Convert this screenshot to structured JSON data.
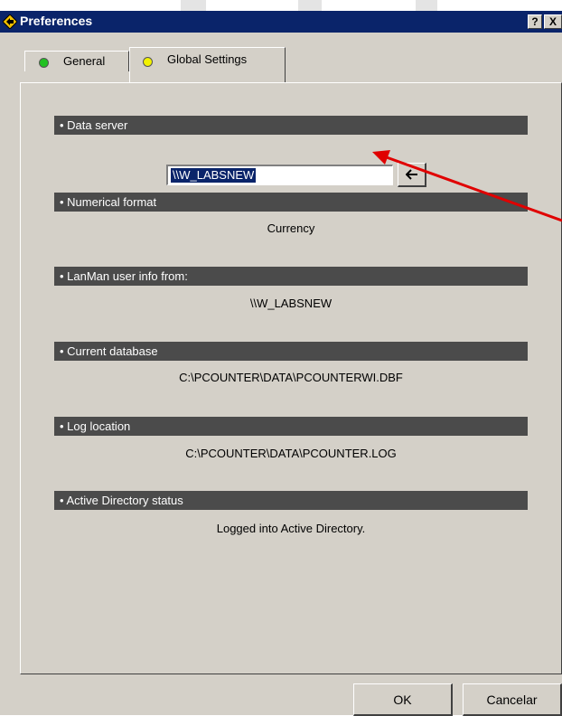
{
  "window": {
    "title": "Preferences",
    "help_label": "?",
    "close_label": "X"
  },
  "tabs": [
    {
      "label": "General",
      "dot_color": "#22c122"
    },
    {
      "label": "Global Settings",
      "dot_color": "#f2f200"
    }
  ],
  "sections": {
    "data_server": {
      "header": "• Data server",
      "input_value": "\\\\W_LABSNEW"
    },
    "numerical_format": {
      "header": "• Numerical format",
      "value": "Currency"
    },
    "lanman": {
      "header": "• LanMan user info from:",
      "value": "\\\\W_LABSNEW"
    },
    "current_database": {
      "header": "• Current database",
      "value": "C:\\PCOUNTER\\DATA\\PCOUNTERWI.DBF"
    },
    "log_location": {
      "header": "• Log location",
      "value": "C:\\PCOUNTER\\DATA\\PCOUNTER.LOG"
    },
    "active_directory": {
      "header": "• Active Directory status",
      "value": "Logged into Active Directory."
    }
  },
  "buttons": {
    "ok": "OK",
    "cancel": "Cancelar"
  },
  "colors": {
    "titlebar": "#0a246a",
    "section_header": "#4b4b4b",
    "annotation_arrow": "#e00000"
  }
}
